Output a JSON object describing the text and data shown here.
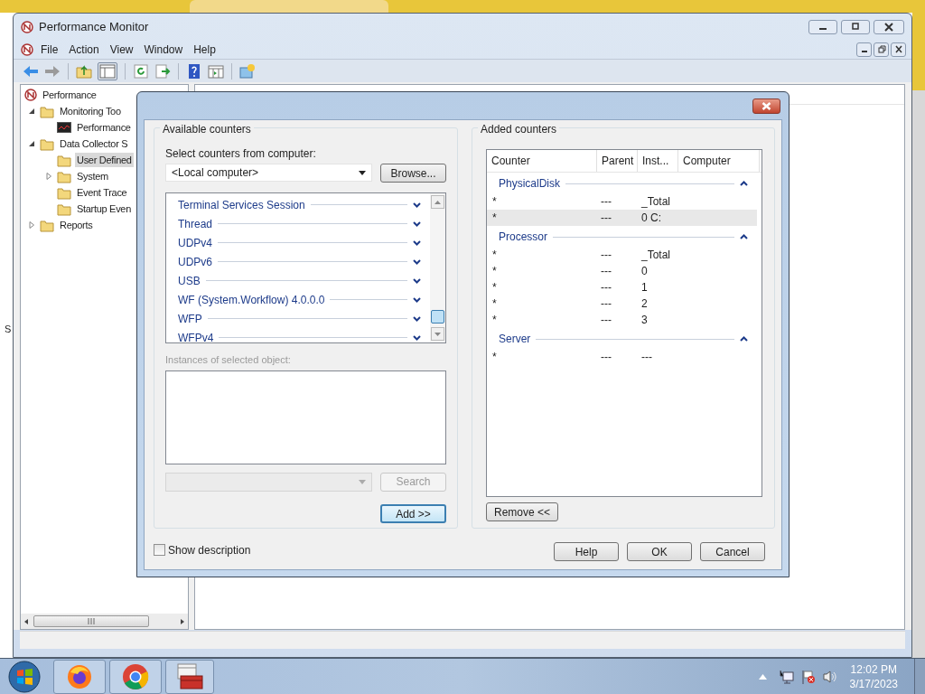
{
  "window": {
    "title": "Performance Monitor"
  },
  "menu": [
    "File",
    "Action",
    "View",
    "Window",
    "Help"
  ],
  "tree": [
    {
      "label": "Performance",
      "kind": "root",
      "selected": false,
      "children": [
        {
          "label": "Monitoring Too",
          "kind": "folder",
          "expanded": true,
          "selected": false,
          "children": [
            {
              "label": "Performance",
              "kind": "graph",
              "selected": false
            }
          ]
        },
        {
          "label": "Data Collector S",
          "kind": "folder",
          "expanded": true,
          "selected": false,
          "children": [
            {
              "label": "User Defined",
              "kind": "folder",
              "selected": true
            },
            {
              "label": "System",
              "kind": "folder",
              "expanded": false,
              "selected": false
            },
            {
              "label": "Event Trace",
              "kind": "folder",
              "selected": false
            },
            {
              "label": "Startup Even",
              "kind": "folder",
              "selected": false
            }
          ]
        },
        {
          "label": "Reports",
          "kind": "folder",
          "expanded": false,
          "selected": false
        }
      ]
    }
  ],
  "edge_text": "S",
  "dialog": {
    "available": {
      "heading": "Available counters",
      "computer_label": "Select counters from computer:",
      "computer": "<Local computer>",
      "browse": "Browse...",
      "objects": [
        {
          "name": "Terminal Services Session",
          "expanded": false
        },
        {
          "name": "Thread",
          "expanded": false
        },
        {
          "name": "UDPv4",
          "expanded": false
        },
        {
          "name": "UDPv6",
          "expanded": false
        },
        {
          "name": "USB",
          "expanded": false
        },
        {
          "name": "WF (System.Workflow) 4.0.0.0",
          "expanded": false
        },
        {
          "name": "WFP",
          "expanded": false
        },
        {
          "name": "WFPv4",
          "expanded": false
        }
      ],
      "instances_label": {
        "text": "Instances of selected object:",
        "disabled": true
      },
      "search": {
        "label": "Search",
        "disabled": true
      },
      "add": {
        "label": "Add >>",
        "default": true
      }
    },
    "added": {
      "heading": "Added counters",
      "columns": [
        "Counter",
        "Parent",
        "Inst...",
        "Computer"
      ],
      "groups": [
        {
          "name": "PhysicalDisk",
          "expanded": true,
          "rows": [
            {
              "counter": "*",
              "parent": "---",
              "instance": "_Total",
              "selected": false
            },
            {
              "counter": "*",
              "parent": "---",
              "instance": "0 C:",
              "selected": true
            }
          ]
        },
        {
          "name": "Processor",
          "expanded": true,
          "rows": [
            {
              "counter": "*",
              "parent": "---",
              "instance": "_Total",
              "selected": false
            },
            {
              "counter": "*",
              "parent": "---",
              "instance": "0",
              "selected": false
            },
            {
              "counter": "*",
              "parent": "---",
              "instance": "1",
              "selected": false
            },
            {
              "counter": "*",
              "parent": "---",
              "instance": "2",
              "selected": false
            },
            {
              "counter": "*",
              "parent": "---",
              "instance": "3",
              "selected": false
            }
          ]
        },
        {
          "name": "Server",
          "expanded": true,
          "rows": [
            {
              "counter": "*",
              "parent": "---",
              "instance": "---",
              "selected": false
            }
          ]
        }
      ],
      "remove": "Remove <<"
    },
    "show_description": {
      "label": "Show description",
      "checked": false
    },
    "buttons": [
      "Help",
      "OK",
      "Cancel"
    ]
  },
  "clock": {
    "time": "12:02 PM",
    "date": "3/17/2023"
  }
}
